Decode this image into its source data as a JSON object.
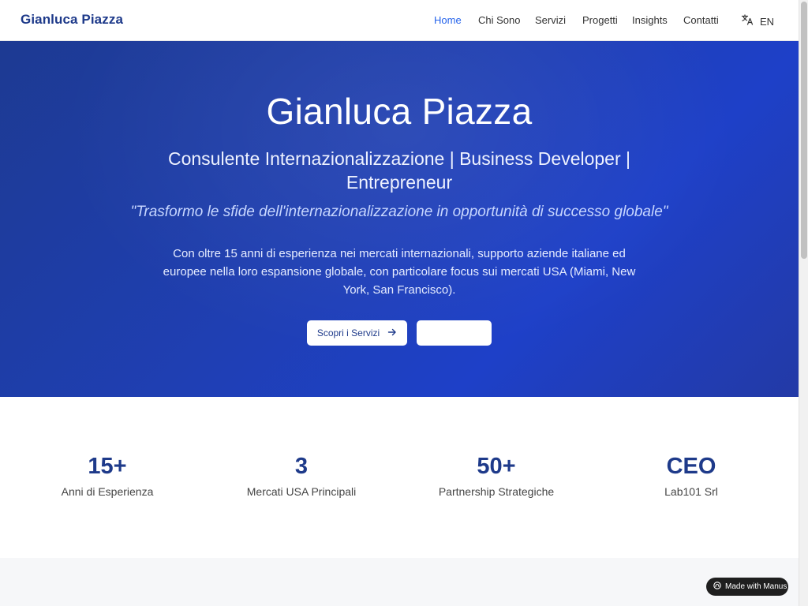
{
  "header": {
    "brand": "Gianluca Piazza",
    "nav": [
      "Home",
      "Chi Sono",
      "Servizi",
      "Progetti",
      "Insights",
      "Contatti"
    ],
    "language": "EN"
  },
  "hero": {
    "title": "Gianluca Piazza",
    "subtitle": "Consulente Internazionalizzazione | Business Developer | Entrepreneur",
    "quote": "\"Trasformo le sfide dell'internazionalizzazione in opportunità di successo globale\"",
    "description": "Con oltre 15 anni di esperienza nei mercati internazionali, supporto aziende italiane ed europee nella loro espansione globale, con particolare focus sui mercati USA (Miami, New York, San Francisco).",
    "primary_button": "Scopri i Servizi",
    "secondary_button": ""
  },
  "stats": [
    {
      "value": "15+",
      "label": "Anni di Esperienza"
    },
    {
      "value": "3",
      "label": "Mercati USA Principali"
    },
    {
      "value": "50+",
      "label": "Partnership Strategiche"
    },
    {
      "value": "CEO",
      "label": "Lab101 Srl"
    }
  ],
  "badge": {
    "label": "Made with Manus"
  },
  "colors": {
    "brand": "#1e3a8a",
    "accent": "#2563eb",
    "hero_gradient_start": "#1d3a92",
    "hero_gradient_end": "#1e40c8"
  },
  "icons": [
    "translate-icon",
    "arrow-right-icon",
    "manus-logo-icon"
  ]
}
